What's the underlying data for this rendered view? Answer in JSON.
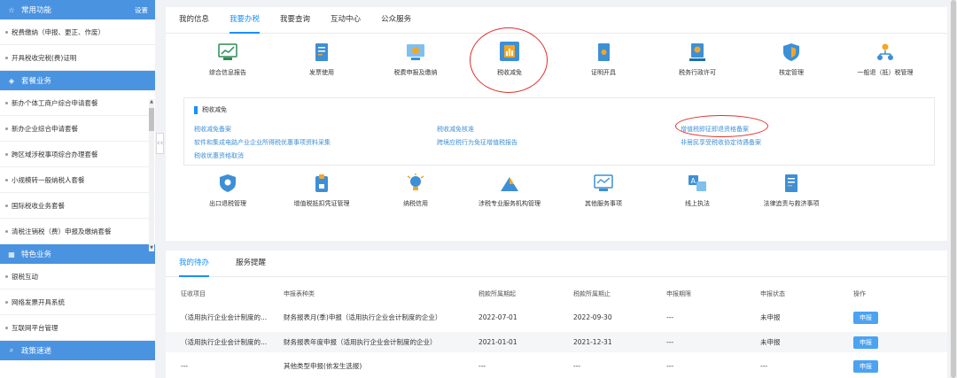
{
  "sidebar": {
    "common": {
      "title": "常用功能",
      "action": "设置",
      "icon": "star-icon",
      "items": [
        "税费缴纳（申报、更正、作废）",
        "开具税收完税(费)证明"
      ]
    },
    "package": {
      "title": "套餐业务",
      "icon": "layers-icon",
      "items": [
        "新办个体工商户综合申请套餐",
        "新办企业综合申请套餐",
        "跨区域涉税事项综合办理套餐",
        "小规模转一般纳税人套餐",
        "国际税收业务套餐",
        "清税注销税（费）申报及缴纳套餐"
      ]
    },
    "special": {
      "title": "特色业务",
      "icon": "grid-icon",
      "items": [
        "银税互动",
        "网络发票开具系统",
        "互联网平台管理"
      ]
    },
    "policy": {
      "title": "政策速递",
      "icon": "search-icon"
    }
  },
  "collapse_glyph": "‹‹",
  "top_tabs": [
    "我的信息",
    "我要办税",
    "我要查询",
    "互动中心",
    "公众服务"
  ],
  "functions_row1": [
    {
      "label": "综合信息报告",
      "icon": "report-chart-icon"
    },
    {
      "label": "发票使用",
      "icon": "invoice-icon"
    },
    {
      "label": "税费申报及缴纳",
      "icon": "declare-icon"
    },
    {
      "label": "税收减免",
      "icon": "tax-reduction-icon"
    },
    {
      "label": "证明开具",
      "icon": "certificate-icon"
    },
    {
      "label": "税务行政许可",
      "icon": "permit-icon"
    },
    {
      "label": "核定管理",
      "icon": "shield-check-icon"
    },
    {
      "label": "一般退（抵）税管理",
      "icon": "refund-icon"
    }
  ],
  "sub": {
    "title": "税收减免",
    "links_col1": [
      "税收减免备案",
      "软件和集成电路产业企业所得税优惠事项资料采集",
      "税收优惠资格取消"
    ],
    "links_col2": [
      "税收减免核准",
      "跨境应税行为免征增值税报告"
    ],
    "links_col3": [
      "增值税即征即退资格备案",
      "非居民享受税收协定待遇备案"
    ]
  },
  "functions_row2": [
    {
      "label": "出口退税管理",
      "icon": "export-refund-icon"
    },
    {
      "label": "增值税抵扣凭证管理",
      "icon": "vat-deduction-icon"
    },
    {
      "label": "纳税信用",
      "icon": "credit-bulb-icon"
    },
    {
      "label": "涉税专业服务机构管理",
      "icon": "agency-icon"
    },
    {
      "label": "其他服务事项",
      "icon": "monitor-icon"
    },
    {
      "label": "线上执法",
      "icon": "translate-icon"
    },
    {
      "label": "法律追责与救济事项",
      "icon": "legal-doc-icon"
    }
  ],
  "bottom_tabs": [
    "我的待办",
    "服务提醒"
  ],
  "table": {
    "headers": [
      "征收项目",
      "申报表种类",
      "税款所属期起",
      "税款所属期止",
      "申报期限",
      "申报状态",
      "操作"
    ],
    "rows": [
      [
        "（适用执行企业会计制度的...",
        "财务报表月(季)申报（适用执行企业会计制度的企业）",
        "2022-07-01",
        "2022-09-30",
        "---",
        "未申报",
        "申报"
      ],
      [
        "（适用执行企业会计制度的...",
        "财务报表年度申报（适用执行企业会计制度的企业）",
        "2021-01-01",
        "2021-12-31",
        "---",
        "未申报",
        "申报"
      ],
      [
        "---",
        "其他类型申报(依发生选报)",
        "---",
        "---",
        "---",
        "---",
        "申报"
      ]
    ]
  }
}
